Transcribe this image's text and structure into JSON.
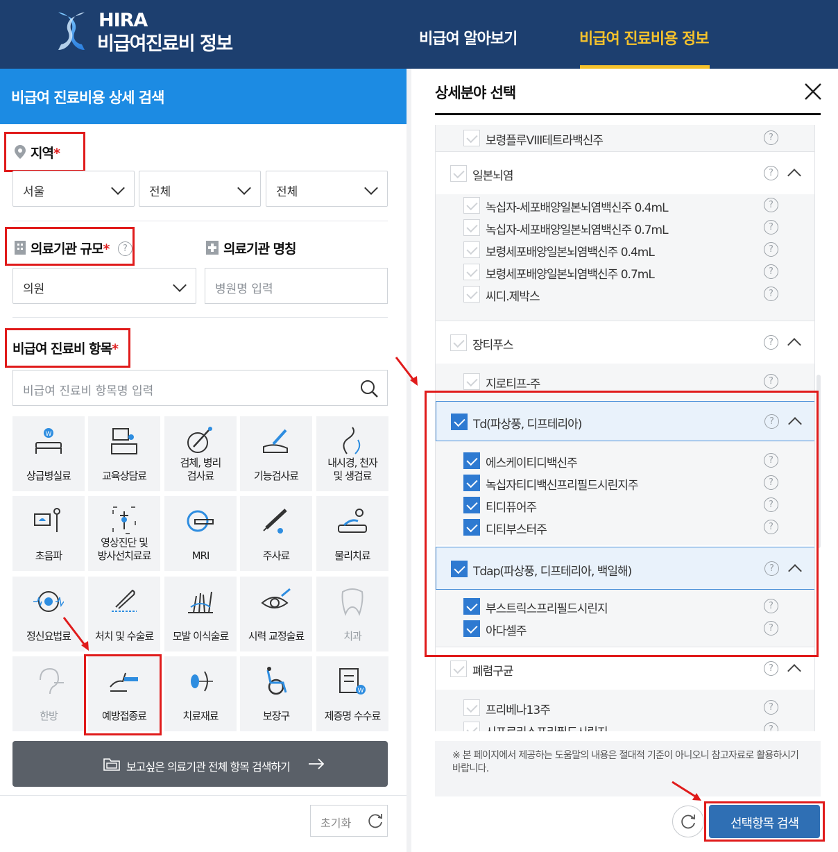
{
  "header": {
    "logo_hira": "HIRA",
    "logo_sub": "비급여진료비 정보",
    "nav": [
      "비급여 알아보기",
      "비급여 진료비용 정보"
    ]
  },
  "left": {
    "title": "비급여 진료비용 상세 검색",
    "region_label": "지역",
    "region_selects": [
      "서울",
      "전체",
      "전체"
    ],
    "scale_label": "의료기관 규모",
    "scale_value": "의원",
    "name_label": "의료기관 명칭",
    "name_placeholder": "병원명 입력",
    "item_label": "비급여 진료비 항목",
    "item_placeholder": "비급여 진료비 항목명 입력",
    "required_mark": "*",
    "tiles": [
      {
        "label": "상급병실료",
        "icon": "bed-icon"
      },
      {
        "label": "교육상담료",
        "icon": "consult-icon"
      },
      {
        "label": "검체, 병리\n검사료",
        "icon": "microscope-icon"
      },
      {
        "label": "기능검사료",
        "icon": "hand-test-icon"
      },
      {
        "label": "내시경, 천자\n및 생검료",
        "icon": "endoscope-icon"
      },
      {
        "label": "초음파",
        "icon": "ultrasound-icon"
      },
      {
        "label": "영상진단 및\n방사선치료료",
        "icon": "xray-icon"
      },
      {
        "label": "MRI",
        "icon": "mri-icon"
      },
      {
        "label": "주사료",
        "icon": "syringe-icon"
      },
      {
        "label": "물리치료",
        "icon": "physio-icon"
      },
      {
        "label": "정신요법료",
        "icon": "brain-icon"
      },
      {
        "label": "처치 및 수술료",
        "icon": "surgery-icon"
      },
      {
        "label": "모발 이식술료",
        "icon": "hair-icon"
      },
      {
        "label": "시력 교정술료",
        "icon": "eye-icon"
      },
      {
        "label": "치과",
        "icon": "tooth-icon"
      },
      {
        "label": "한방",
        "icon": "ear-icon"
      },
      {
        "label": "예방접종료",
        "icon": "vaccine-icon"
      },
      {
        "label": "치료재료",
        "icon": "material-icon"
      },
      {
        "label": "보장구",
        "icon": "wheelchair-icon"
      },
      {
        "label": "제증명 수수료",
        "icon": "certificate-icon"
      }
    ],
    "all_button": "보고싶은 의료기관 전체 항목 검색하기",
    "reset_button": "초기화"
  },
  "right": {
    "title": "상세분야 선택",
    "help_glyph": "?",
    "rows": [
      {
        "type": "item",
        "label": "보령플루VIII테트라백신주",
        "checked": false
      },
      {
        "type": "group",
        "label": "일본뇌염",
        "checked": false
      },
      {
        "type": "item",
        "label": "녹십자-세포배양일본뇌염백신주 0.4mL",
        "checked": false
      },
      {
        "type": "item",
        "label": "녹십자-세포배양일본뇌염백신주 0.7mL",
        "checked": false
      },
      {
        "type": "item",
        "label": "보령세포배양일본뇌염백신주 0.4mL",
        "checked": false
      },
      {
        "type": "item",
        "label": "보령세포배양일본뇌염백신주 0.7mL",
        "checked": false
      },
      {
        "type": "item",
        "label": "씨디.제박스",
        "checked": false
      },
      {
        "type": "group",
        "label": "장티푸스",
        "checked": false
      },
      {
        "type": "item",
        "label": "지로티프-주",
        "checked": false
      },
      {
        "type": "group",
        "label": "Td(파상풍, 디프테리아)",
        "checked": true
      },
      {
        "type": "item",
        "label": "에스케이티디백신주",
        "checked": true
      },
      {
        "type": "item",
        "label": "녹십자티디백신프리필드시린지주",
        "checked": true
      },
      {
        "type": "item",
        "label": "티디퓨어주",
        "checked": true
      },
      {
        "type": "item",
        "label": "디티부스터주",
        "checked": true
      },
      {
        "type": "group",
        "label": "Tdap(파상풍, 디프테리아, 백일해)",
        "checked": true
      },
      {
        "type": "item",
        "label": "부스트릭스프리필드시린지",
        "checked": true
      },
      {
        "type": "item",
        "label": "아다셀주",
        "checked": true
      },
      {
        "type": "group",
        "label": "폐렴구균",
        "checked": false
      },
      {
        "type": "item",
        "label": "프리베나13주",
        "checked": false
      },
      {
        "type": "item",
        "label": "시프로리스프리필드시린지",
        "checked": false
      }
    ],
    "notice": "※ 본 페이지에서 제공하는 도움말의 내용은 절대적 기준이 아니오니 참고자료로 활용하시기 바랍니다.",
    "search_button": "선택항목 검색"
  },
  "colors": {
    "header": "#1d3f6f",
    "accent": "#f5c22c",
    "title_bar": "#1c8be3",
    "highlight": "#e01b1b",
    "checked": "#2e7ad1"
  }
}
